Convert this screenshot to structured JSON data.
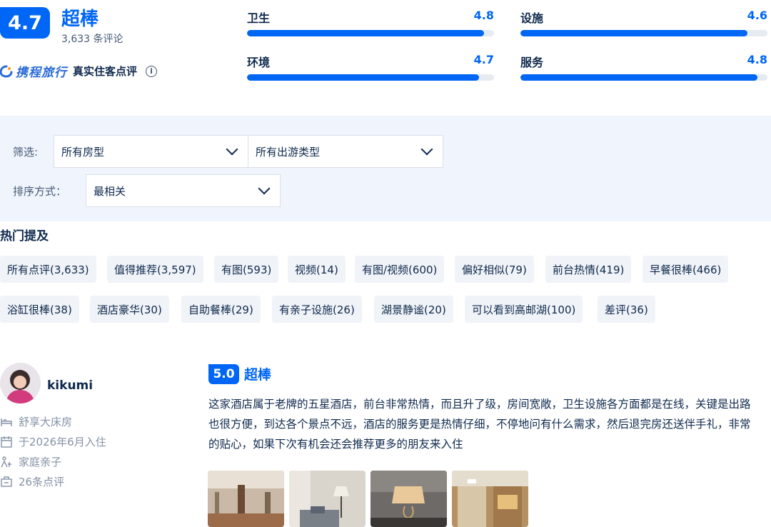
{
  "overall": {
    "score": "4.7",
    "label": "超棒",
    "review_count": "3,633 条评论",
    "brand_name": "携程旅行",
    "brand_suffix": "真实住客点评",
    "info_icon": "i"
  },
  "sub_scores": [
    {
      "name": "卫生",
      "value": "4.8",
      "fraction": 0.96
    },
    {
      "name": "设施",
      "value": "4.6",
      "fraction": 0.92
    },
    {
      "name": "环境",
      "value": "4.7",
      "fraction": 0.94
    },
    {
      "name": "服务",
      "value": "4.8",
      "fraction": 0.96
    }
  ],
  "filters": {
    "filter_label": "筛选:",
    "room_type": "所有房型",
    "trip_type": "所有出游类型",
    "sort_label": "排序方式：",
    "sort_value": "最相关"
  },
  "hot_mentions": {
    "title": "热门提及",
    "tags": [
      "所有点评(3,633)",
      "值得推荐(3,597)",
      "有图(593)",
      "视频(14)",
      "有图/视频(600)",
      "偏好相似(79)",
      "前台热情(419)",
      "早餐很棒(466)",
      "浴缸很棒(38)",
      "酒店豪华(30)",
      "自助餐棒(29)",
      "有亲子设施(26)",
      "湖景静谧(20)",
      "可以看到高邮湖(100)",
      "差评(36)"
    ]
  },
  "review": {
    "username": "kikumi",
    "room": "舒享大床房",
    "stay_date": "于2026年6月入住",
    "trip_type": "家庭亲子",
    "user_review_count": "26条点评",
    "score": "5.0",
    "score_label": "超棒",
    "text": "这家酒店属于老牌的五星酒店，前台非常热情，而且升了级，房间宽敞，卫生设施各方面都是在线，关键是出路也很方便，到达各个景点不远，酒店的服务更是热情仔细，不停地问有什么需求，然后退完房还送伴手礼，非常的贴心，如果下次有机会还会推荐更多的朋友来入住"
  },
  "colors": {
    "accent": "#0066f6",
    "text": "#0f294d",
    "muted": "#8592a6",
    "panel": "#f0f5fd"
  }
}
